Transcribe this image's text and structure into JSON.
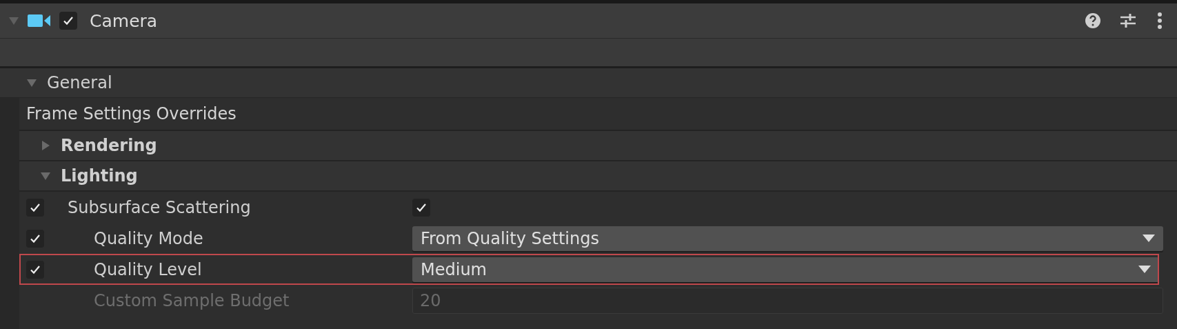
{
  "component": {
    "title": "Camera",
    "enabled": true,
    "expanded": true
  },
  "section": {
    "title": "General",
    "expanded": true
  },
  "group": {
    "title": "Frame Settings Overrides"
  },
  "categories": [
    {
      "title": "Rendering",
      "expanded": false
    },
    {
      "title": "Lighting",
      "expanded": true
    }
  ],
  "rows": [
    {
      "label": "Subsurface Scattering",
      "override": true,
      "kind": "toggle",
      "checked": true,
      "disabled": false,
      "children": [
        {
          "label": "Quality Mode",
          "override": true,
          "kind": "dropdown",
          "value": "From Quality Settings",
          "disabled": false
        },
        {
          "label": "Quality Level",
          "override": true,
          "kind": "dropdown",
          "value": "Medium",
          "disabled": false,
          "highlighted": true
        },
        {
          "label": "Custom Sample Budget",
          "kind": "number",
          "value": "20",
          "disabled": true
        }
      ]
    }
  ]
}
